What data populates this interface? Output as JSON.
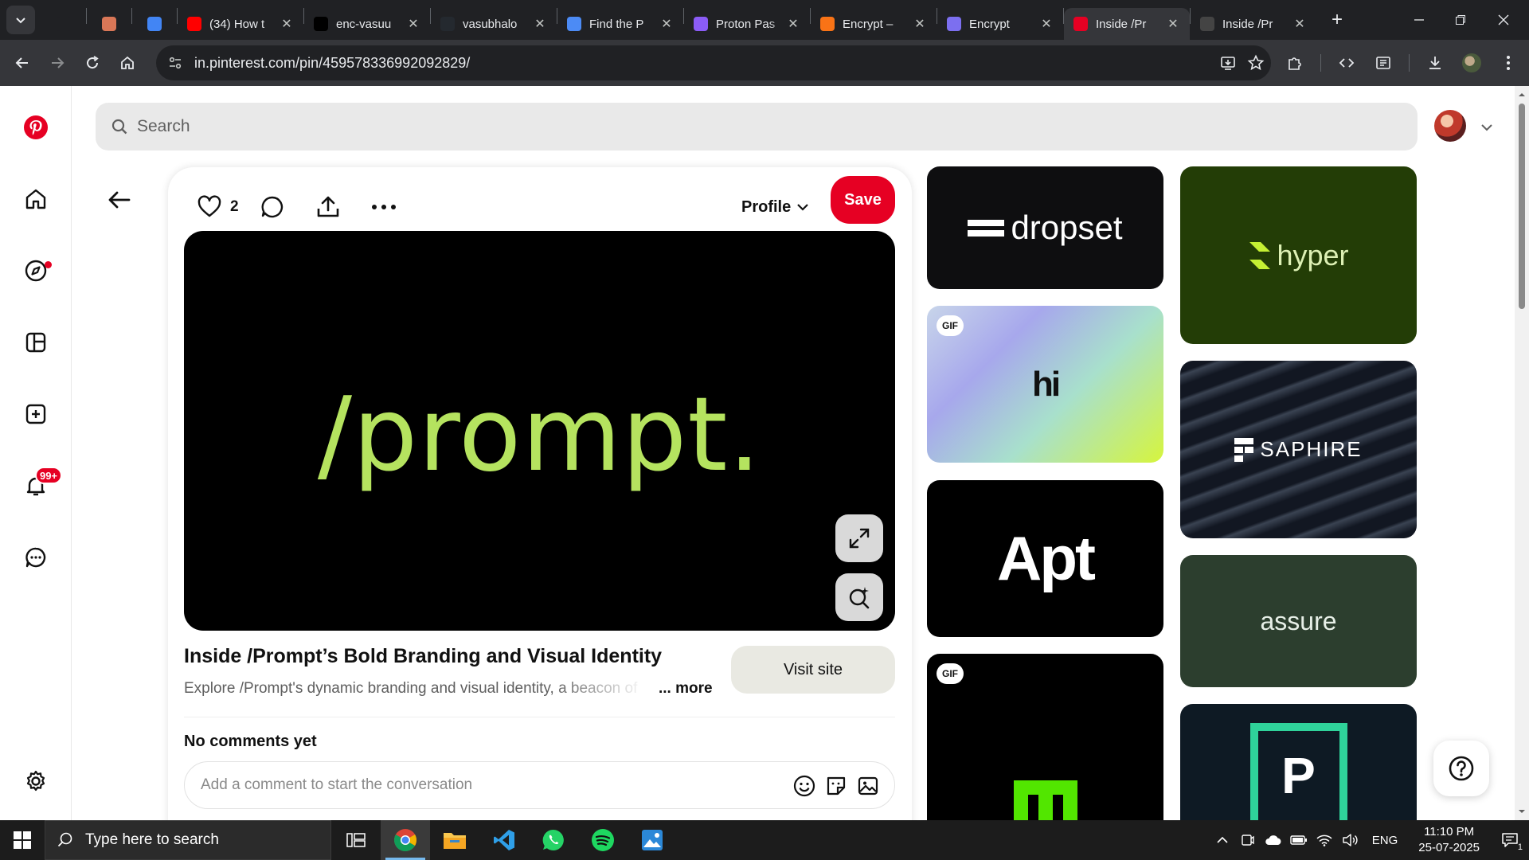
{
  "browser": {
    "tabs": [
      {
        "label": "",
        "favicon": "chatgpt-icon",
        "color": "#202124",
        "active": false
      },
      {
        "label": "",
        "favicon": "claude-icon",
        "color": "#d97757",
        "active": false
      },
      {
        "label": "",
        "favicon": "gemini-icon",
        "color": "#4285f4",
        "active": false
      },
      {
        "label": "(34) How t",
        "favicon": "youtube-icon",
        "color": "#ff0000",
        "active": false
      },
      {
        "label": "enc-vasuu",
        "favicon": "vercel-icon",
        "color": "#000000",
        "active": false
      },
      {
        "label": "vasubhalo",
        "favicon": "github-icon",
        "color": "#24292f",
        "active": false
      },
      {
        "label": "Find the P",
        "favicon": "flag-icon",
        "color": "#4c8bf5",
        "active": false
      },
      {
        "label": "Proton Pas",
        "favicon": "proton-pass-icon",
        "color": "#8b5cf6",
        "active": false
      },
      {
        "label": "Encrypt –",
        "favicon": "fire-icon",
        "color": "#f97316",
        "active": false
      },
      {
        "label": "Encrypt",
        "favicon": "hexagon-icon",
        "color": "#7c6ff0",
        "active": false
      },
      {
        "label": "Inside /Pr",
        "favicon": "pinterest-icon",
        "color": "#e60023",
        "active": true
      },
      {
        "label": "Inside /Pr",
        "favicon": "site-icon",
        "color": "#444444",
        "active": false
      }
    ],
    "url": "in.pinterest.com/pin/459578336992092829/"
  },
  "pinterest": {
    "search": {
      "placeholder": "Search"
    },
    "pin": {
      "like_count": "2",
      "profile_label": "Profile",
      "save_label": "Save",
      "image_text": "/prompt.",
      "title": "Inside /Prompt’s Bold Branding and Visual Identity",
      "description": "Explore /Prompt's dynamic branding and visual identity, a beacon of",
      "more_label": "... more",
      "visit_label": "Visit site",
      "comments_heading": "No comments yet",
      "comment_placeholder": "Add a comment to start the conversation"
    },
    "notifications_badge": "99+",
    "related": [
      {
        "name": "dropset",
        "text": "dropset",
        "bg": "#0e0e10",
        "fg": "#ffffff",
        "gif": false
      },
      {
        "name": "hi",
        "text": "hi",
        "bg": "#b9c6e8",
        "fg": "#111111",
        "gif": true
      },
      {
        "name": "apt",
        "text": "Apt",
        "bg": "#000000",
        "fg": "#ffffff",
        "gif": false
      },
      {
        "name": "m-gif",
        "text": "",
        "bg": "#000000",
        "fg": "#52e600",
        "gif": true
      },
      {
        "name": "hyper",
        "text": "hyper",
        "bg": "#233d06",
        "fg": "#ddf0b4",
        "gif": false
      },
      {
        "name": "saphire",
        "text": "SAPHIRE",
        "bg": "#1d2430",
        "fg": "#ffffff",
        "gif": false
      },
      {
        "name": "assure",
        "text": "assure",
        "bg": "#2c3e2e",
        "fg": "#e7efe7",
        "gif": false
      },
      {
        "name": "p-logo",
        "text": "P",
        "bg": "#0e1a24",
        "fg": "#ffffff",
        "gif": false
      }
    ],
    "gif_label": "GIF"
  },
  "taskbar": {
    "search_placeholder": "Type here to search",
    "language": "ENG",
    "time": "11:10 PM",
    "date": "25-07-2025",
    "notification_count": "1"
  },
  "colors": {
    "pinterest_red": "#e60023",
    "prompt_green": "#b5e35f"
  }
}
